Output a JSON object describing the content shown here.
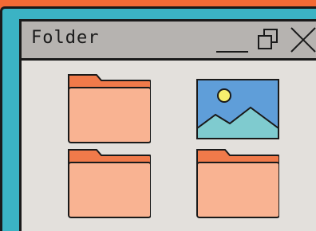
{
  "window": {
    "title": "Folder",
    "controls": [
      "minimize-icon",
      "restore-icon",
      "close-icon"
    ]
  },
  "icons": [
    "folder-icon",
    "image-file-icon",
    "folder-icon",
    "folder-icon"
  ],
  "colors": {
    "top_bar": "#f26a35",
    "desktop": "#3bb3c4",
    "window_body": "#e3e0dc",
    "title_bar": "#b6b3b0",
    "folder_front": "#f9b392",
    "folder_back": "#f07a4a",
    "image_sky": "#5f9ed9",
    "image_hills": "#7fcbcf",
    "image_sun": "#f6ef6e",
    "outline": "#1a1a1a"
  }
}
